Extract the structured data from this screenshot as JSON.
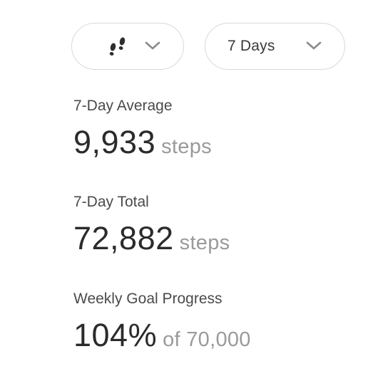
{
  "filters": {
    "metric": {
      "icon": "footsteps-icon"
    },
    "range": {
      "label": "7 Days"
    }
  },
  "stats": [
    {
      "label": "7-Day Average",
      "value": "9,933",
      "unit": "steps"
    },
    {
      "label": "7-Day Total",
      "value": "72,882",
      "unit": "steps"
    },
    {
      "label": "Weekly Goal Progress",
      "value": "104%",
      "unit": "of 70,000"
    }
  ],
  "colors": {
    "pill_border": "#d9d9d9",
    "label_text": "#4a4a4a",
    "value_text": "#2b2b2b",
    "unit_text": "#9a9a9a",
    "chevron": "#8a8a8a"
  }
}
